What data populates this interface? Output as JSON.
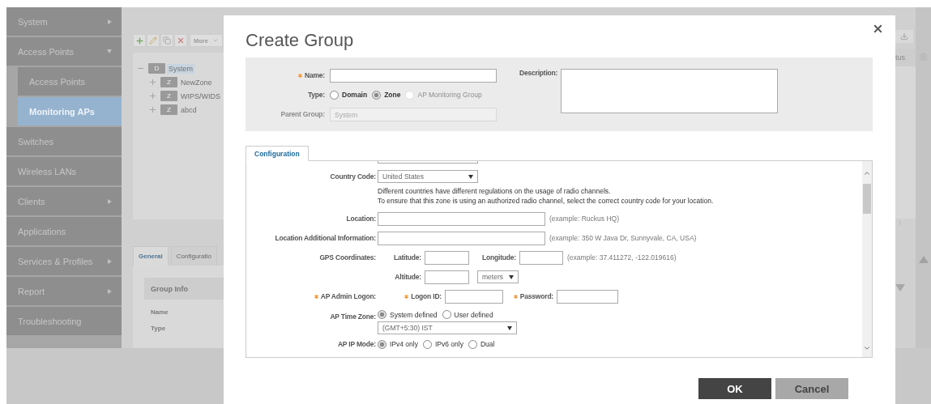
{
  "sidebar": {
    "items": [
      {
        "label": "System",
        "selected": false,
        "expanded": false
      },
      {
        "label": "Access Points",
        "selected": false,
        "expanded": true,
        "children": [
          {
            "label": "Access Points",
            "selected": false
          },
          {
            "label": "Monitoring APs",
            "selected": true
          }
        ]
      },
      {
        "label": "Switches",
        "selected": false
      },
      {
        "label": "Wireless LANs",
        "selected": false
      },
      {
        "label": "Clients",
        "selected": false,
        "expanded": false
      },
      {
        "label": "Applications",
        "selected": false
      },
      {
        "label": "Services & Profiles",
        "selected": false,
        "expanded": false
      },
      {
        "label": "Report",
        "selected": false,
        "expanded": false
      },
      {
        "label": "Troubleshooting",
        "selected": false
      }
    ]
  },
  "toolbar": {
    "more": "More"
  },
  "tree": [
    {
      "badge": "D",
      "label": "System",
      "selected": true,
      "expanded": true,
      "children": [
        {
          "badge": "Z",
          "label": "NewZone",
          "selected": false,
          "expanded": false
        },
        {
          "badge": "Z",
          "label": "WIPS/WIDS",
          "selected": false,
          "expanded": false
        },
        {
          "badge": "Z",
          "label": "abcd",
          "selected": false,
          "expanded": false
        }
      ]
    }
  ],
  "detail_tabs": [
    {
      "label": "General",
      "selected": true
    },
    {
      "label": "Configuratio",
      "selected": false
    }
  ],
  "group_info": {
    "title": "Group Info",
    "fields": [
      "Name",
      "Type"
    ]
  },
  "right_panel": {
    "column_header": "tus"
  },
  "dialog": {
    "title": "Create Group",
    "name": {
      "label": "Name:",
      "required": true
    },
    "type": {
      "label": "Type:",
      "options": [
        {
          "label": "Domain",
          "selected": false,
          "disabled": false
        },
        {
          "label": "Zone",
          "selected": true,
          "disabled": false
        },
        {
          "label": "AP Monitoring Group",
          "selected": false,
          "disabled": true
        }
      ]
    },
    "parent_group": {
      "label": "Parent Group:",
      "value": "System",
      "disabled": true
    },
    "description": {
      "label": "Description:"
    },
    "tabs": [
      {
        "label": "Configuration",
        "selected": true
      }
    ],
    "rows": [
      {
        "kind": "select",
        "label": "Country Code:",
        "value": "United States",
        "note": [
          "Different countries have different regulations on the usage of radio channels.",
          "To ensure that this zone is using an authorized radio channel, select the correct country code for your location."
        ]
      },
      {
        "kind": "text",
        "label": "Location:",
        "hint": "(example: Ruckus HQ)"
      },
      {
        "kind": "text",
        "label": "Location Additional Information:",
        "hint": "(example: 350 W Java Dr, Sunnyvale, CA, USA)"
      },
      {
        "kind": "gps",
        "label": "GPS Coordinates:",
        "latitude_label": "Latitude:",
        "longitude_label": "Longitude:",
        "hint": "(example: 37.411272, -122.019616)",
        "altitude_label": "Altitude:",
        "unit": "meters"
      },
      {
        "kind": "logon",
        "label": "AP Admin Logon:",
        "required": true,
        "fields": [
          {
            "label": "Logon ID:",
            "required": true
          },
          {
            "label": "Password:",
            "required": true
          }
        ]
      },
      {
        "kind": "radio_select",
        "label": "AP Time Zone:",
        "options": [
          {
            "label": "System defined",
            "selected": true
          },
          {
            "label": "User defined",
            "selected": false
          }
        ],
        "value": "(GMT+5:30) IST"
      },
      {
        "kind": "radio",
        "label": "AP IP Mode:",
        "options": [
          {
            "label": "IPv4 only",
            "selected": true
          },
          {
            "label": "IPv6 only",
            "selected": false
          },
          {
            "label": "Dual",
            "selected": false
          }
        ]
      }
    ],
    "buttons": [
      {
        "label": "OK",
        "kind": "primary"
      },
      {
        "label": "Cancel",
        "kind": "secondary"
      }
    ]
  }
}
